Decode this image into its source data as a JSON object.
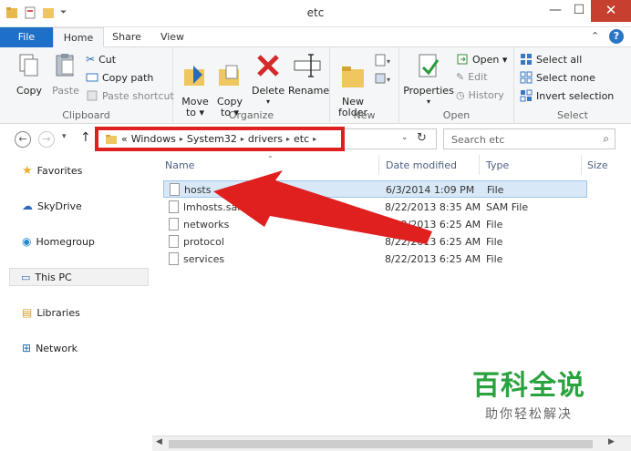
{
  "window": {
    "title": "etc",
    "minimize": "—",
    "maximize": "☐",
    "close": "✕"
  },
  "tabs": {
    "file": "File",
    "home": "Home",
    "share": "Share",
    "view": "View"
  },
  "ribbon": {
    "clipboard": {
      "label": "Clipboard",
      "copy": "Copy",
      "paste": "Paste",
      "cut": "Cut",
      "copy_path": "Copy path",
      "paste_shortcut": "Paste shortcut"
    },
    "organize": {
      "label": "Organize",
      "move_to": "Move\nto ▾",
      "copy_to": "Copy\nto ▾",
      "delete": "Delete",
      "rename": "Rename"
    },
    "new": {
      "label": "New",
      "new_folder": "New\nfolder"
    },
    "open": {
      "label": "Open",
      "properties": "Properties",
      "open": "Open ▾",
      "edit": "Edit",
      "history": "History"
    },
    "select": {
      "label": "Select",
      "select_all": "Select all",
      "select_none": "Select none",
      "invert_selection": "Invert selection"
    }
  },
  "address": {
    "prefix": "«",
    "crumbs": [
      "Windows",
      "System32",
      "drivers",
      "etc"
    ]
  },
  "search": {
    "placeholder": "Search etc"
  },
  "nav": {
    "favorites": "Favorites",
    "skydrive": "SkyDrive",
    "homegroup": "Homegroup",
    "thispc": "This PC",
    "libraries": "Libraries",
    "network": "Network"
  },
  "columns": {
    "name": "Name",
    "date": "Date modified",
    "type": "Type",
    "size": "Size"
  },
  "files": [
    {
      "name": "hosts",
      "date": "6/3/2014 1:09 PM",
      "type": "File"
    },
    {
      "name": "lmhosts.sam",
      "date": "8/22/2013 8:35 AM",
      "type": "SAM File"
    },
    {
      "name": "networks",
      "date": "8/22/2013 6:25 AM",
      "type": "File"
    },
    {
      "name": "protocol",
      "date": "8/22/2013 6:25 AM",
      "type": "File"
    },
    {
      "name": "services",
      "date": "8/22/2013 6:25 AM",
      "type": "File"
    }
  ],
  "watermark": {
    "big": "百科全说",
    "small": "助你轻松解决"
  },
  "colors": {
    "accent": "#1e6fc8",
    "highlight": "#e01f1f",
    "watermark": "#2aa33f"
  }
}
